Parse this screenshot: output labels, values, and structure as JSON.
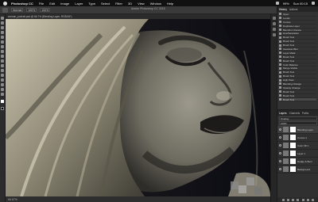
{
  "menubar": {
    "app_name": "Photoshop CC",
    "items": [
      "File",
      "Edit",
      "Image",
      "Layer",
      "Type",
      "Select",
      "Filter",
      "3D",
      "View",
      "Window",
      "Help"
    ],
    "battery": "99%",
    "clock": "Sun 00:15"
  },
  "options": {
    "window_title": "Adobe Photoshop CC 2015",
    "field1": "Normal",
    "field2": "100%",
    "field3": "100%"
  },
  "document": {
    "tab_label": "woman_portrait.psd @ 66.7% (Blending Layer, RGB/16*)",
    "status": "66.67%"
  },
  "panels": {
    "tabs": [
      "History",
      "Actions"
    ],
    "history": [
      "Open",
      "Levels",
      "Curves",
      "Duplicate Layer",
      "Blending Change",
      "Hue/Saturation",
      "Brush Tool",
      "Brush Tool",
      "Brush Tool",
      "Gaussian Blur",
      "Layer Mask",
      "Brush Tool",
      "Brush Tool",
      "Color Balance",
      "Merge Visible",
      "Brush Tool",
      "Brush Tool",
      "High Pass",
      "Blending Change",
      "Opacity Change",
      "Brush Tool",
      "Brush Tool",
      "Brush Tool"
    ],
    "layers_tabs": [
      "Layers",
      "Channels",
      "Paths"
    ],
    "blend_mode": "Overlay",
    "opacity": "100%",
    "layers": [
      {
        "name": "Blending Layer"
      },
      {
        "name": "Curves 1"
      },
      {
        "name": "Color Fill 1"
      },
      {
        "name": "Layer 1"
      },
      {
        "name": "Dodge & Burn"
      },
      {
        "name": "Background"
      }
    ]
  },
  "colors": {
    "foreground": "#ffffff",
    "background": "#000000",
    "accent": "#4a4a4a"
  }
}
